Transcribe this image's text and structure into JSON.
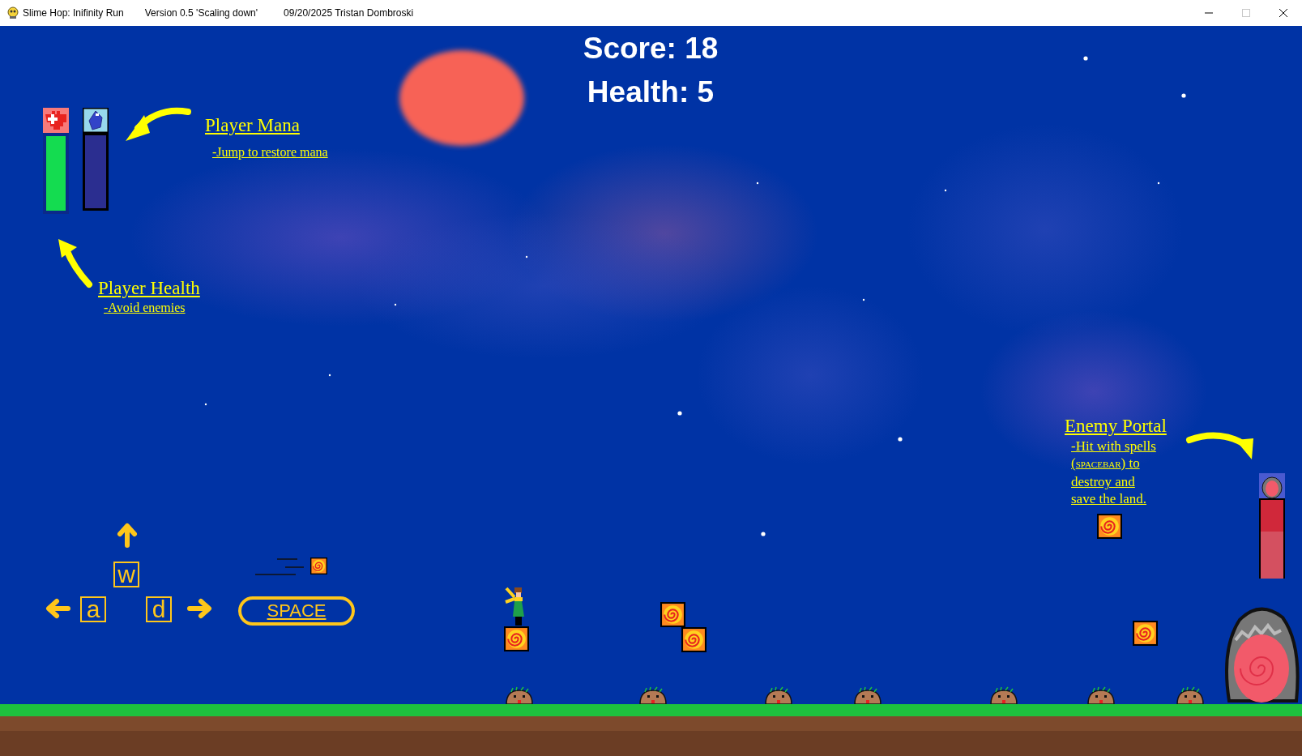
{
  "window": {
    "title": "Slime Hop: Inifinity Run",
    "version": "Version 0.5 'Scaling down'",
    "credit": "09/20/2025 Tristan Dombroski",
    "controls": [
      {
        "kind": "minimize",
        "disabled": false
      },
      {
        "kind": "maximize",
        "disabled": true
      },
      {
        "kind": "close",
        "disabled": false
      }
    ]
  },
  "hud": {
    "score": "Score: 18",
    "health": "Health: 5",
    "health_bar": {
      "level": 1
    },
    "mana_bar": {
      "level": 1
    },
    "portal_bar": {
      "level": 0.4
    }
  },
  "tutorial": {
    "mana": {
      "title": "Player Mana",
      "hint": "-Jump to restore mana"
    },
    "health": {
      "title": "Player Health",
      "hint": "-Avoid enemies"
    },
    "portal": {
      "title": "Enemy Portal",
      "hint_before": "-Hit with spells (",
      "hint_key": "SPACEBAR",
      "hint_after": ") to destroy and save the land."
    }
  },
  "keys": [
    {
      "kind": "up",
      "label": "w"
    },
    {
      "kind": "left",
      "label": "a"
    },
    {
      "kind": "right",
      "label": "d"
    },
    {
      "kind": "spell",
      "label": "SPACE"
    }
  ]
}
